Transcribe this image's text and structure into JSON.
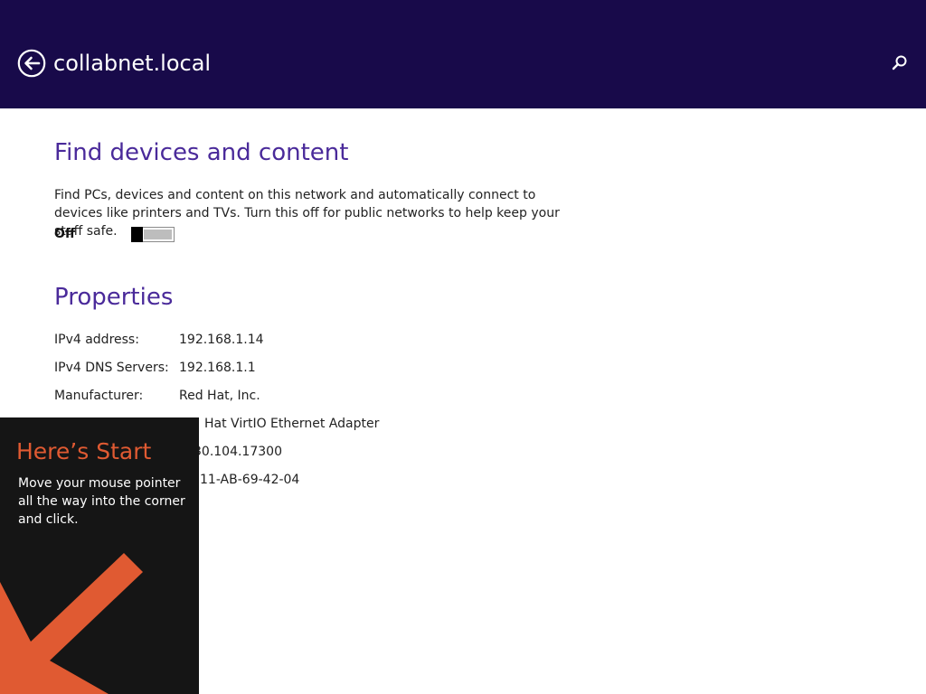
{
  "header": {
    "title": "collabnet.local",
    "icons": {
      "back": "back-arrow-circle-icon",
      "search": "search-icon"
    }
  },
  "find_devices": {
    "title": "Find devices and content",
    "description": "Find PCs, devices and content on this network and automatically connect to devices like printers and TVs. Turn this off for public networks to help keep your stuff safe.",
    "toggle_state_label": "Off",
    "toggle_on": false
  },
  "properties": {
    "title": "Properties",
    "rows": [
      {
        "label": "IPv4 address:",
        "value": "192.168.1.14"
      },
      {
        "label": "IPv4 DNS Servers:",
        "value": "192.168.1.1"
      },
      {
        "label": "Manufacturer:",
        "value": "Red Hat, Inc."
      },
      {
        "label": "",
        "value": "Hat VirtIO Ethernet Adapter"
      },
      {
        "label": "",
        "value": "30.104.17300"
      },
      {
        "label": "",
        "value": "11-AB-69-42-04"
      }
    ]
  },
  "start_tip": {
    "title": "Here’s Start",
    "text": "Move your mouse pointer all the way into the corner and click."
  },
  "colors": {
    "header_bg": "#180a4a",
    "accent_purple": "#4a2a9a",
    "tip_bg": "#151515",
    "tip_accent": "#e05a32"
  }
}
